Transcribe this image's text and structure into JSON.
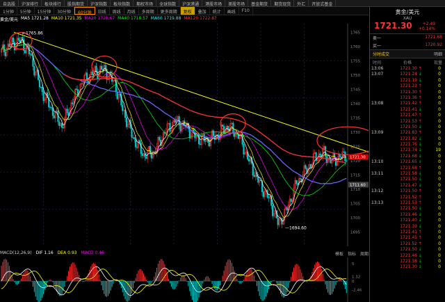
{
  "menu": [
    "自选股",
    "沪深排行",
    "板块排行",
    "股指期货",
    "沪深指数",
    "板块指数",
    "期权市场",
    "全球指数",
    "沪深港通",
    "港股市场",
    "美股市场",
    "基金期货",
    "期货现货",
    "外汇",
    "开放式基金"
  ],
  "tabs": [
    {
      "label": "1分钟",
      "state": "normal"
    },
    {
      "label": "5分钟",
      "state": "normal"
    },
    {
      "label": "15分钟",
      "state": "normal"
    },
    {
      "label": "30分钟",
      "state": "normal"
    },
    {
      "label": "60分钟",
      "state": "active"
    },
    {
      "label": "日线",
      "state": "normal"
    },
    {
      "label": "周线",
      "state": "normal"
    },
    {
      "label": "月线",
      "state": "normal"
    },
    {
      "label": "多周期",
      "state": "normal"
    },
    {
      "label": "更多周期",
      "state": "normal"
    },
    {
      "label": "复权",
      "state": "highlight"
    },
    {
      "label": "叠加",
      "state": "normal"
    },
    {
      "label": "统计",
      "state": "normal"
    },
    {
      "label": "画线",
      "state": "normal"
    },
    {
      "label": "F10",
      "state": "normal"
    }
  ],
  "chart_info": {
    "name": "黄金/美元",
    "ma_items": [
      {
        "label": "MA5 1721.28",
        "color": "#ffffff"
      },
      {
        "label": "MA10 1721.35",
        "color": "#ffff00"
      },
      {
        "label": "MA20 1720.67",
        "color": "#ff00ff"
      },
      {
        "label": "MA40 1718.57",
        "color": "#00ff00"
      },
      {
        "label": "MA60 1719.88",
        "color": "#00ffff"
      },
      {
        "label": "MA120 1722.87",
        "color": "#ff3333"
      }
    ]
  },
  "annotations": {
    "high_label": "1765.86",
    "low_label": "1694.60"
  },
  "indicator": {
    "name": "MACD(12,26,9)",
    "values": [
      {
        "label": "DIF 1.16",
        "color": "#ffffff"
      },
      {
        "label": "DEA 0.93",
        "color": "#ffff00"
      },
      {
        "label": "MACD 0.46",
        "color": "#ff00ff"
      }
    ],
    "buttons": [
      "模板",
      "指标",
      "周期"
    ]
  },
  "price_axis": [
    "1765",
    "1760",
    "1755",
    "1750",
    "1745",
    "1740",
    "1735",
    "1730",
    "1725",
    "1720",
    "1715",
    "1710",
    "1705",
    "1700",
    "1695"
  ],
  "price_axis_current": "1721.30",
  "price_axis_secondary": "1711.60",
  "indicator_axis": [
    "5",
    "1.32",
    "0",
    "-2.46"
  ],
  "colors": {
    "up": "#ff3333",
    "down": "#00cc00",
    "trend": "#ffff00",
    "circle": "#ff3333"
  },
  "right_panel": {
    "title": "黄金/美元",
    "symbol": "XAU",
    "price": "1721.30",
    "change": "+2.49",
    "change_pct": "+0.14%",
    "sell_label": "卖一",
    "sell_price": "1721.68",
    "buy_label": "买一",
    "buy_price": "1720.92",
    "section_label": "分时成交",
    "section_right": "明细",
    "col_time": "时间",
    "col_price": "价格",
    "col_vol": "现量",
    "ticks": [
      {
        "time": "13:06",
        "price": "1721.30",
        "dir": "↑",
        "vol": "0"
      },
      {
        "time": "13:07",
        "price": "1721.24",
        "dir": "↓",
        "vol": "0"
      },
      {
        "time": "",
        "price": "1721.19",
        "dir": "↓",
        "vol": "0"
      },
      {
        "time": "",
        "price": "1721.23",
        "dir": "↑",
        "vol": "0"
      },
      {
        "time": "",
        "price": "1721.30",
        "dir": "↑",
        "vol": "0"
      },
      {
        "time": "",
        "price": "1721.36",
        "dir": "↑",
        "vol": "0"
      },
      {
        "time": "13:08",
        "price": "1721.42",
        "dir": "↑",
        "vol": "0"
      },
      {
        "time": "",
        "price": "1721.41",
        "dir": "↓",
        "vol": "0"
      },
      {
        "time": "",
        "price": "1721.47",
        "dir": "↑",
        "vol": "0"
      },
      {
        "time": "",
        "price": "1721.53",
        "dir": "↑",
        "vol": "0"
      },
      {
        "time": "",
        "price": "1721.50",
        "dir": "↓",
        "vol": "0"
      },
      {
        "time": "13:09",
        "price": "1721.83",
        "dir": "↑",
        "vol": "0"
      },
      {
        "time": "",
        "price": "1721.82",
        "dir": "↓",
        "vol": "0"
      },
      {
        "time": "",
        "price": "1721.76",
        "dir": "↓",
        "vol": "0"
      },
      {
        "time": "",
        "price": "1721.74",
        "dir": "↓",
        "vol": "19"
      },
      {
        "time": "",
        "price": "1721.68",
        "dir": "↓",
        "vol": "0"
      },
      {
        "time": "13:10",
        "price": "1721.65",
        "dir": "↓",
        "vol": "0"
      },
      {
        "time": "",
        "price": "1721.68",
        "dir": "↑",
        "vol": "0"
      },
      {
        "time": "13:11",
        "price": "1721.58",
        "dir": "↓",
        "vol": "0"
      },
      {
        "time": "",
        "price": "1721.50",
        "dir": "↓",
        "vol": "0"
      },
      {
        "time": "",
        "price": "1721.47",
        "dir": "↓",
        "vol": "0"
      },
      {
        "time": "13:12",
        "price": "1721.50",
        "dir": "↑",
        "vol": "0"
      },
      {
        "time": "",
        "price": "1721.52",
        "dir": "↑",
        "vol": "0"
      },
      {
        "time": "13:13",
        "price": "1721.53",
        "dir": "↑",
        "vol": "0"
      },
      {
        "time": "",
        "price": "1721.50",
        "dir": "↓",
        "vol": "0"
      },
      {
        "time": "",
        "price": "1721.46",
        "dir": "↓",
        "vol": "0"
      },
      {
        "time": "",
        "price": "1721.40",
        "dir": "↓",
        "vol": "0"
      },
      {
        "time": "",
        "price": "1721.39",
        "dir": "↓",
        "vol": "0"
      },
      {
        "time": "",
        "price": "1721.41",
        "dir": "↑",
        "vol": "0"
      },
      {
        "time": "",
        "price": "1721.45",
        "dir": "↑",
        "vol": "0"
      },
      {
        "time": "",
        "price": "1721.52",
        "dir": "↑",
        "vol": "0"
      },
      {
        "time": "",
        "price": "1721.50",
        "dir": "↓",
        "vol": "0"
      },
      {
        "time": "",
        "price": "1721.46",
        "dir": "↓",
        "vol": "0"
      },
      {
        "time": "",
        "price": "1721.38",
        "dir": "↓",
        "vol": "0"
      },
      {
        "time": "",
        "price": "1721.30",
        "dir": "↓",
        "vol": "0"
      }
    ]
  }
}
